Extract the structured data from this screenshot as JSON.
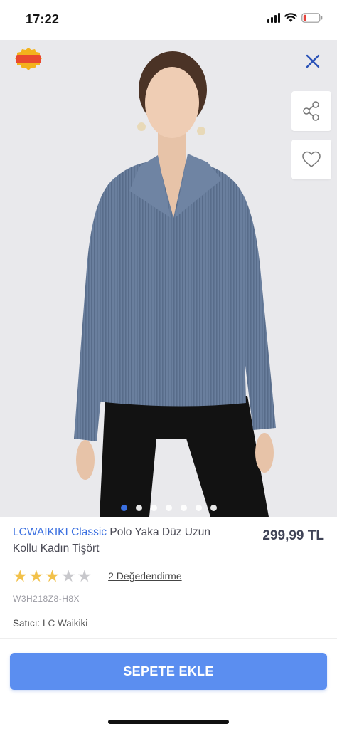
{
  "status_bar": {
    "time": "17:22"
  },
  "image_overlay": {
    "coupon_badge_line1": "Süper",
    "coupon_badge_line2": "Kupon",
    "dot_count": 7,
    "active_dot": 0
  },
  "product": {
    "brand": "LCWAIKIKI Classic",
    "name": "Polo Yaka Düz Uzun Kollu Kadın Tişört",
    "price": "299,99 TL",
    "rating": 3,
    "rating_max": 5,
    "review_link": "2 Değerlendirme",
    "sku": "W3H218Z8-H8X",
    "seller_label": "Satıcı:",
    "seller_name": "LC Waikiki"
  },
  "actions": {
    "add_to_cart": "SEPETE EKLE"
  },
  "colors": {
    "accent": "#3a6fe0",
    "button": "#5b8ef0",
    "star": "#f2c14a"
  },
  "icons": [
    "signal-icon",
    "wifi-icon",
    "battery-icon",
    "coupon-icon",
    "close-icon",
    "share-icon",
    "heart-icon",
    "star-icon"
  ]
}
